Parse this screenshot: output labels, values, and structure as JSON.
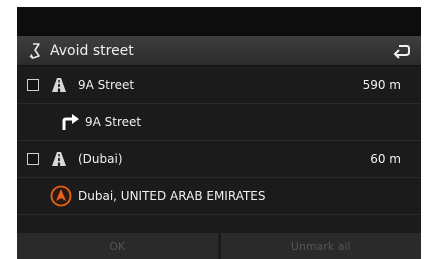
{
  "header": {
    "title": "Avoid street",
    "title_icon": "avoid-route-icon",
    "back_icon": "back-arrow-icon"
  },
  "rows": [
    {
      "type": "road",
      "icon": "road-icon",
      "label": "9A Street",
      "distance": "590 m",
      "checked": false
    },
    {
      "type": "maneuver",
      "icon": "turn-right-arrow-icon",
      "label": "9A Street"
    },
    {
      "type": "road",
      "icon": "road-icon",
      "label": "(Dubai)",
      "distance": "60 m",
      "checked": false
    },
    {
      "type": "destination",
      "icon": "destination-marker-icon",
      "label": "Dubai, UNITED ARAB EMIRATES"
    }
  ],
  "buttons": {
    "ok": "OK",
    "unmark_all": "Unmark all"
  },
  "colors": {
    "background": "#1b1b1b",
    "header": "#3a3a3a",
    "accent_orange": "#e8641e",
    "disabled_text": "#555555"
  }
}
